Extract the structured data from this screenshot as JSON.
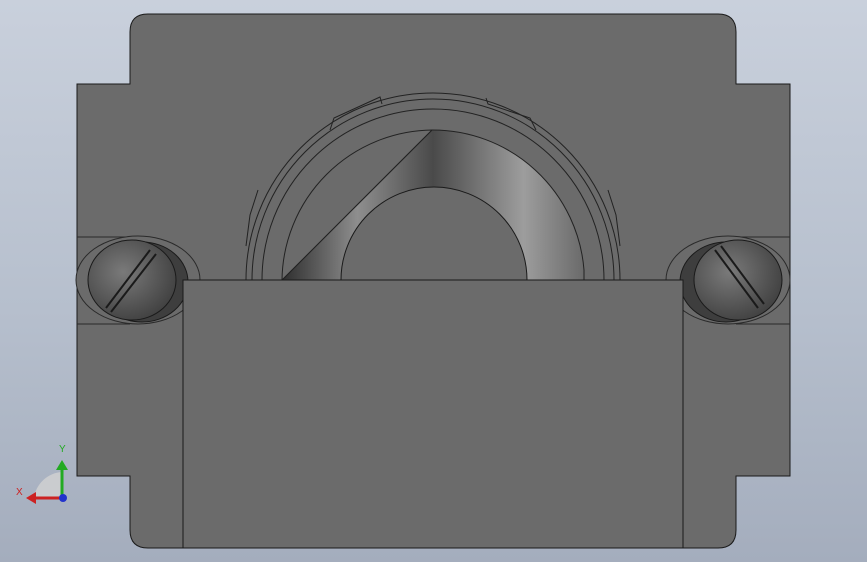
{
  "viewport": {
    "background_top": "#c9d0dc",
    "background_bottom": "#a4adbd"
  },
  "model": {
    "body_color": "#6b6b6b",
    "edge_color": "#1a1a1a",
    "bore_color": "#9a9a9a",
    "screw_count": 2,
    "screw_icon": "slotted-screw-icon"
  },
  "triad": {
    "x_label": "X",
    "y_label": "Y",
    "x_color": "#cc2222",
    "y_color": "#22aa22",
    "z_color": "#2233cc"
  }
}
